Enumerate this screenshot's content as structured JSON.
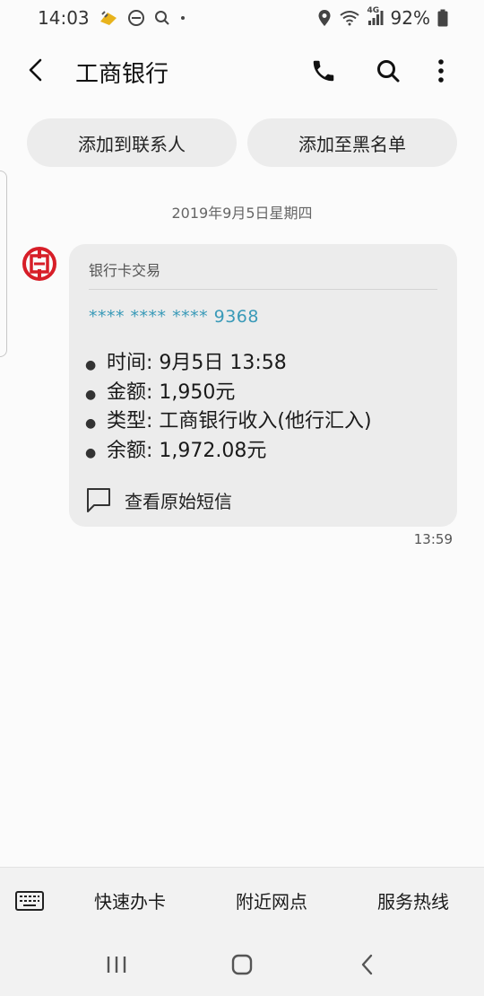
{
  "status_bar": {
    "time": "14:03",
    "network_label": "4G",
    "battery": "92%"
  },
  "header": {
    "title": "工商银行",
    "icons": [
      "back-arrow-icon",
      "phone-icon",
      "search-icon",
      "more-vertical-icon"
    ]
  },
  "actions": {
    "add_contact": "添加到联系人",
    "add_blacklist": "添加至黑名单"
  },
  "conversation": {
    "date": "2019年9月5日星期四",
    "message": {
      "title": "银行卡交易",
      "card_number": "**** **** **** 9368",
      "details": [
        "时间: 9月5日 13:58",
        "金额: 1,950元",
        "类型: 工商银行收入(他行汇入)",
        "余额: 1,972.08元"
      ],
      "view_original": "查看原始短信",
      "time": "13:59"
    }
  },
  "bottom_menu": {
    "items": [
      "快速办卡",
      "附近网点",
      "服务热线"
    ]
  },
  "colors": {
    "brand_red": "#d71e28",
    "card_number_blue": "#3a9ab8",
    "bubble_bg": "#ececec",
    "background": "#fbfbfb"
  }
}
